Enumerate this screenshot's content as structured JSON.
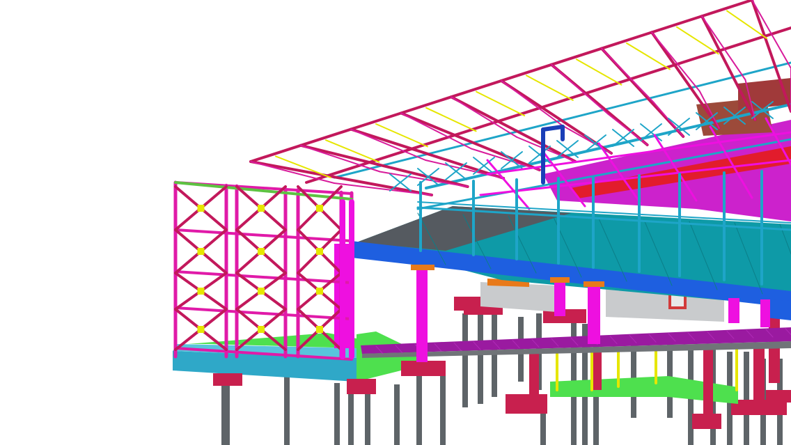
{
  "viewport": {
    "background": "#ffffff",
    "view": "3d-perspective",
    "content": "bim-structural-model"
  },
  "palette": {
    "roof_truss": "#c2185b",
    "truss_web": "#d81b9b",
    "purlin": "#e6e600",
    "bracing_cyan": "#1ea5c8",
    "slab_teal": "#0e9aa7",
    "slab_dark": "#555a60",
    "beam_blue": "#1e5fe0",
    "column_magenta": "#ee10e0",
    "pile_cap": "#c8204e",
    "pile_grey": "#5e6468",
    "green_slab": "#4ee04e",
    "purple_deck": "#9a1aa0",
    "frame_pink": "#e01aa8",
    "base_slab": "#2fa8c8",
    "roof_fill": "#cc22cc",
    "red_beam": "#e21c2c"
  }
}
